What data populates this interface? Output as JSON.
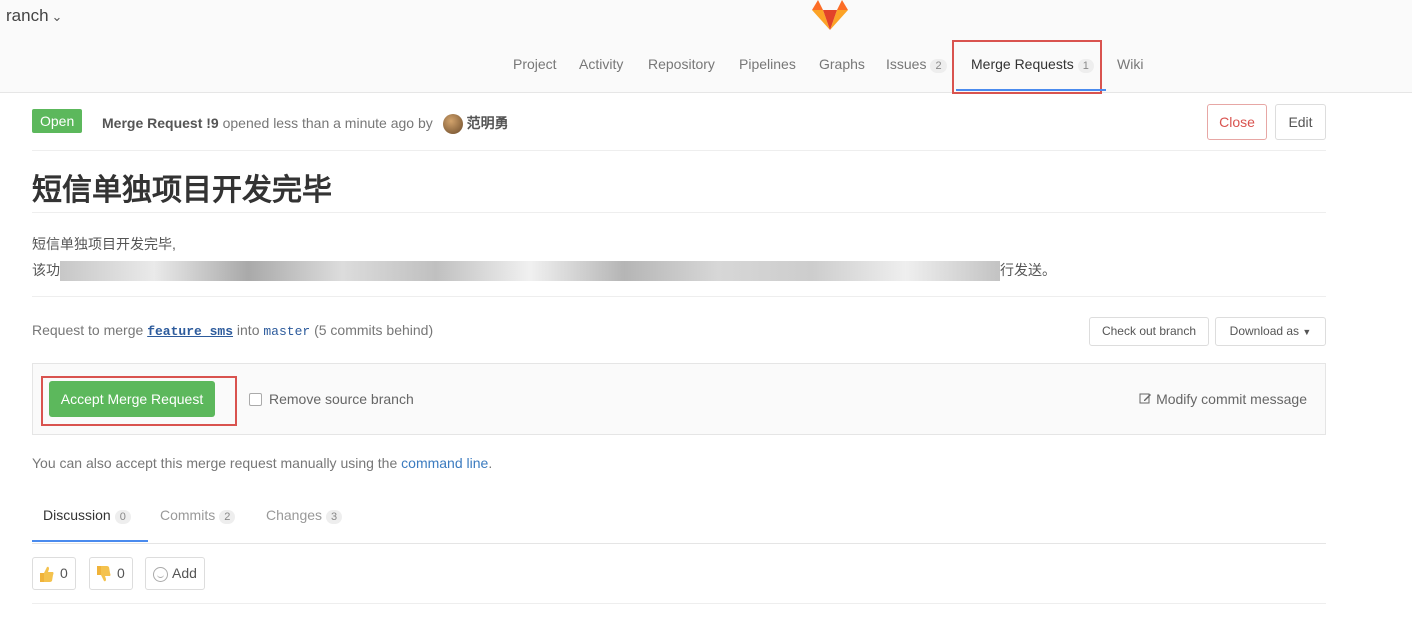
{
  "branch": {
    "label": "ranch"
  },
  "nav": {
    "items": [
      {
        "label": "Project"
      },
      {
        "label": "Activity"
      },
      {
        "label": "Repository"
      },
      {
        "label": "Pipelines"
      },
      {
        "label": "Graphs"
      },
      {
        "label": "Issues",
        "count": "2"
      },
      {
        "label": "Merge Requests",
        "count": "1"
      },
      {
        "label": "Wiki"
      }
    ]
  },
  "header": {
    "status": "Open",
    "mr_ref": "Merge Request !9",
    "meta": "opened less than a minute ago by",
    "author": "范明勇",
    "close_label": "Close",
    "edit_label": "Edit"
  },
  "title": "短信单独项目开发完毕",
  "description": {
    "line1": "短信单独项目开发完毕,",
    "line2_start": "该功",
    "line2_end": "行发送。"
  },
  "merge": {
    "prefix": "Request to merge",
    "source": "feature_sms",
    "into": "into",
    "target": "master",
    "behind": "(5 commits behind)",
    "checkout_label": "Check out branch",
    "download_label": "Download as"
  },
  "accept": {
    "button_label": "Accept Merge Request",
    "remove_label": "Remove source branch",
    "modify_label": "Modify commit message"
  },
  "manual": {
    "text": "You can also accept this merge request manually using the",
    "link": "command line",
    "end": "."
  },
  "tabs": [
    {
      "label": "Discussion",
      "count": "0"
    },
    {
      "label": "Commits",
      "count": "2"
    },
    {
      "label": "Changes",
      "count": "3"
    }
  ],
  "awards": {
    "thumbsup_count": "0",
    "thumbsdown_count": "0",
    "add_label": "Add"
  },
  "colors": {
    "accent": "#4a8bee",
    "success": "#5cb85c",
    "danger": "#d9534f"
  }
}
